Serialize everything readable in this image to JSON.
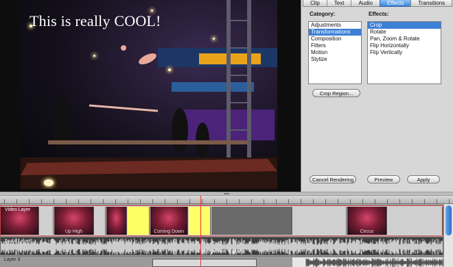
{
  "preview": {
    "caption": "This is really COOL!"
  },
  "tabs": [
    {
      "label": "Clip",
      "active": false
    },
    {
      "label": "Text",
      "active": false
    },
    {
      "label": "Audio",
      "active": false
    },
    {
      "label": "Effects",
      "active": true
    },
    {
      "label": "Transitions",
      "active": false
    }
  ],
  "category": {
    "label": "Category:",
    "items": [
      "Adjustments",
      "Transformations",
      "Composition",
      "Filters",
      "Motion",
      "Stylize"
    ],
    "selected": "Transformations"
  },
  "effects": {
    "label": "Effects:",
    "items": [
      "Crop",
      "Rotate",
      "Pan, Zoom & Rotate",
      "Flip Horizontally",
      "Flip Vertically"
    ],
    "selected": "Crop"
  },
  "buttons": {
    "crop_region": "Crop Region...",
    "cancel_rendering": "Cancel Rendering",
    "preview": "Preview",
    "apply": "Apply"
  },
  "timeline": {
    "video_track_label": "Video Layer",
    "audio_track_label": "Audio Layer",
    "layer3_label": "Layer 3",
    "audio_clip_label": "Ready When You Are",
    "clips": [
      {
        "label": "",
        "style": "thumb"
      },
      {
        "label": "",
        "style": "gray"
      },
      {
        "label": "Up High",
        "style": "thumb"
      },
      {
        "label": "",
        "style": "gray"
      },
      {
        "label": "",
        "style": "thumb"
      },
      {
        "label": "",
        "style": "yellow"
      },
      {
        "label": "Coming Down",
        "style": "thumb"
      },
      {
        "label": "",
        "style": "yellow"
      },
      {
        "label": "",
        "style": "dark"
      },
      {
        "label": "",
        "style": "gray"
      },
      {
        "label": "Circus",
        "style": "thumb"
      },
      {
        "label": "",
        "style": "gray"
      }
    ]
  },
  "colors": {
    "selection": "#3d80d6",
    "playhead": "#e33333",
    "title_clip": "#ffff66"
  }
}
